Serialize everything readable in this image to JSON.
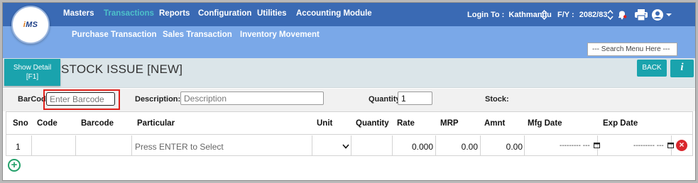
{
  "nav": {
    "logo_text": "iMS",
    "items": [
      "Masters",
      "Transactions",
      "Reports",
      "Configuration",
      "Utilities",
      "Accounting Module"
    ],
    "active": "Transactions",
    "sub_items": [
      "Purchase Transaction",
      "Sales Transaction",
      "Inventory Movement"
    ],
    "login_label": "Login To :",
    "login_value": "Kathmandu",
    "fy_label": "F/Y :",
    "fy_value": "2082/83",
    "search_placeholder": "--- Search Menu Here ---"
  },
  "toolbar": {
    "show_detail_line1": "Show Detail",
    "show_detail_line2": "[F1]",
    "title": "STOCK ISSUE [NEW]",
    "back_label": "BACK",
    "info_label": "i"
  },
  "form": {
    "barcode_label": "BarCode",
    "barcode_placeholder": "Enter Barcode",
    "description_label": "Description:",
    "description_placeholder": "Description",
    "quantity_label": "Quantity",
    "quantity_value": "1",
    "stock_label": "Stock:"
  },
  "table": {
    "columns": [
      "Sno",
      "Code",
      "Barcode",
      "Particular",
      "Unit",
      "Quantity",
      "Rate",
      "MRP",
      "Amnt",
      "Mfg Date",
      "Exp Date"
    ],
    "rows": [
      {
        "sno": "1",
        "code": "",
        "barcode": "",
        "particular_placeholder": "Press ENTER to Select",
        "unit": "",
        "quantity": "",
        "rate": "0.000",
        "mrp": "0.00",
        "amnt": "0.00",
        "mfg_date": "--------- ---",
        "exp_date": "--------- ---"
      }
    ]
  },
  "colors": {
    "topbar": "#3a6ab4",
    "subbar": "#7aa8e8",
    "accent": "#1aa3ad",
    "active_nav": "#4dc1c9",
    "delete": "#d9272d",
    "add": "#23a06a",
    "highlight": "#e0221c"
  }
}
